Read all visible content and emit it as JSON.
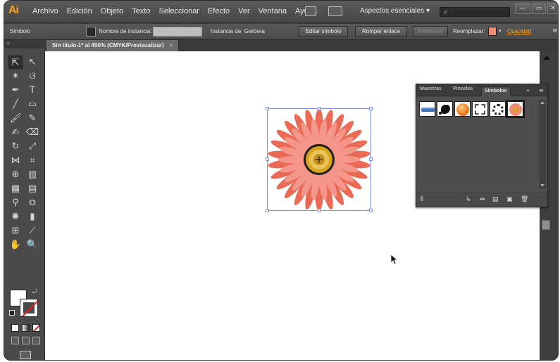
{
  "app": {
    "logo": "Ai"
  },
  "menu": [
    "Archivo",
    "Edición",
    "Objeto",
    "Texto",
    "Seleccionar",
    "Efecto",
    "Ver",
    "Ventana",
    "Ayuda"
  ],
  "workspace": "Aspectos esenciales  ▾",
  "window_controls": [
    "—",
    "▭",
    "✕"
  ],
  "control_bar": {
    "selection_label": "Símbolo",
    "instance_name_label": "Nombre de instancia:",
    "instance_of_label": "Instancia de: Gerbera",
    "edit_symbol": "Editar símbolo",
    "break_link": "Romper enlace",
    "reset": "Restaurar",
    "replace_label": "Reemplazar:",
    "opacity_link": "Opacidad"
  },
  "document_tab": {
    "title": "Sin título-1* al 400% (CMYK/Previsualizar)",
    "close": "×"
  },
  "symbols_panel": {
    "tabs": [
      "Muestras",
      "Pinceles",
      "Símbolos"
    ],
    "active_tab": "Símbolos",
    "symbols": [
      "blue-banner-symbol",
      "black-splatter-symbol",
      "orange-sphere-symbol",
      "grunge-frame-symbol",
      "dotted-ring-symbol",
      "gerbera-symbol"
    ],
    "selected_symbol": "gerbera-symbol"
  },
  "colors": {
    "accent": "#f7a21b",
    "flower_petal": "#f08a70",
    "selection": "#7a8ef0",
    "flower_center": "#d9a320"
  }
}
